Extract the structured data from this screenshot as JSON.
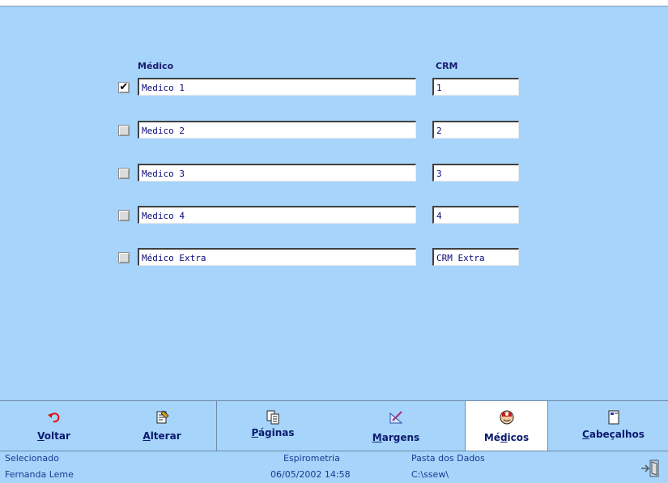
{
  "columns": {
    "medico": "Médico",
    "crm": "CRM"
  },
  "rows": [
    {
      "checked": true,
      "name": "Medico 1",
      "crm": "1"
    },
    {
      "checked": false,
      "name": "Medico 2",
      "crm": "2"
    },
    {
      "checked": false,
      "name": "Medico 3",
      "crm": "3"
    },
    {
      "checked": false,
      "name": "Medico 4",
      "crm": "4"
    },
    {
      "checked": false,
      "name": "Médico Extra",
      "crm": "CRM Extra"
    }
  ],
  "checkmark": "✔",
  "toolbar": {
    "voltar": {
      "label_u": "V",
      "label_rest": "oltar",
      "icon": "undo-icon"
    },
    "alterar": {
      "label_u": "A",
      "label_rest": "lterar",
      "icon": "edit-doc-icon"
    },
    "paginas": {
      "label_u": "P",
      "label_rest": "áginas",
      "icon": "pages-icon"
    },
    "margens": {
      "label_u": "M",
      "label_rest": "argens",
      "icon": "margins-icon"
    },
    "medicos": {
      "label_pre": "Mé",
      "label_u": "d",
      "label_rest": "icos",
      "icon": "doctor-icon"
    },
    "cabecalhos": {
      "label_u": "C",
      "label_rest": "abeçalhos",
      "icon": "header-icon"
    }
  },
  "status": {
    "selecionado": "Selecionado",
    "user": "Fernanda Leme",
    "module": "Espirometria",
    "datetime": "06/05/2002 14:58",
    "folder_label": "Pasta dos Dados",
    "folder_path": "C:\\ssew\\"
  },
  "colors": {
    "background": "#a6d4fb",
    "text": "#000080",
    "active_tab": "#ffffff"
  }
}
